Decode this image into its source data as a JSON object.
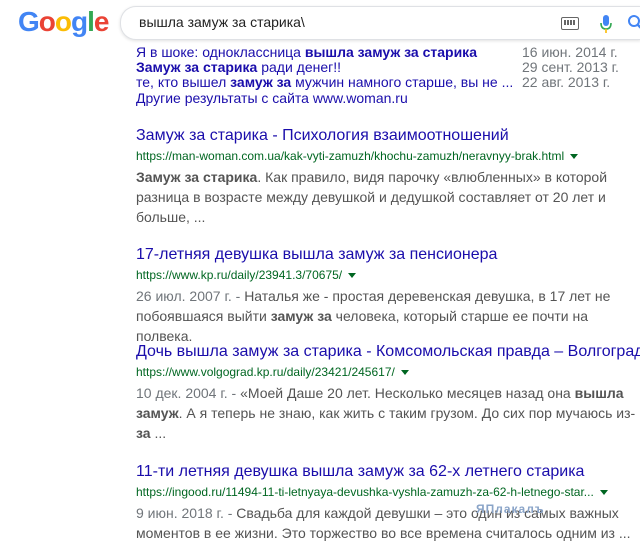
{
  "logo": {
    "letters": [
      "G",
      "o",
      "o",
      "g",
      "l",
      "e"
    ],
    "colors": [
      "#4285F4",
      "#EA4335",
      "#FBBC05",
      "#4285F4",
      "#34A853",
      "#EA4335"
    ]
  },
  "search": {
    "query": "вышла замуж за старика\\"
  },
  "sitelinks": [
    {
      "pre": "Я в шоке: одноклассница ",
      "bold": "вышла замуж за старика",
      "post": "",
      "date": "16 июн. 2014 г."
    },
    {
      "pre": "",
      "bold": "Замуж за старика",
      "post": " ради денег!!",
      "date": "29 сент. 2013 г."
    },
    {
      "pre": "те, кто вышел ",
      "bold": "замуж за",
      "post": " мужчин намного старше, вы не ...",
      "date": "22 авг. 2013 г."
    }
  ],
  "more_results": "Другие результаты с сайта www.woman.ru",
  "results": [
    {
      "title": "Замуж за старика - Психология взаимоотношений",
      "url": "https://man-woman.com.ua/kak-vyti-zamuzh/khochu-zamuzh/neravnyy-brak.html",
      "date": "",
      "snippet": [
        {
          "b": true,
          "t": "Замуж за старика"
        },
        {
          "b": false,
          "t": ". Как правило, видя парочку «влюбленных» в которой разница в возрасте между девушкой и дедушкой составляет от 20 лет и больше, ..."
        }
      ]
    },
    {
      "title": "17-летняя девушка вышла замуж за пенсионера",
      "url": "https://www.kp.ru/daily/23941.3/70675/",
      "date": "26 июл. 2007 г. - ",
      "snippet": [
        {
          "b": false,
          "t": "Наталья же - простая деревенская девушка, в 17 лет не побоявшаяся выйти "
        },
        {
          "b": true,
          "t": "замуж за"
        },
        {
          "b": false,
          "t": " человека, который старше ее почти на полвека."
        }
      ]
    },
    {
      "title": "Дочь вышла замуж за старика - Комсомольская правда – Волгоград",
      "url": "https://www.volgograd.kp.ru/daily/23421/245617/",
      "date": "10 дек. 2004 г. - ",
      "snippet": [
        {
          "b": false,
          "t": "«Моей Даше 20 лет. Несколько месяцев назад она "
        },
        {
          "b": true,
          "t": "вышла замуж"
        },
        {
          "b": false,
          "t": ". А я теперь не знаю, как жить с таким грузом. До сих пор мучаюсь из-"
        },
        {
          "b": true,
          "t": "за"
        },
        {
          "b": false,
          "t": " ..."
        }
      ]
    },
    {
      "title": "11-ти летняя девушка вышла замуж за 62-х летнего старика",
      "url": "https://ingood.ru/11494-11-ti-letnyaya-devushka-vyshla-zamuzh-za-62-h-letnego-star...",
      "date": "9 июн. 2018 г. - ",
      "snippet": [
        {
          "b": false,
          "t": "Свадьба для каждой девушки – это один из самых важных моментов в ее жизни. Это торжество во все времена считалось одним из ..."
        }
      ]
    }
  ],
  "watermark": "ЯПлакалъ"
}
